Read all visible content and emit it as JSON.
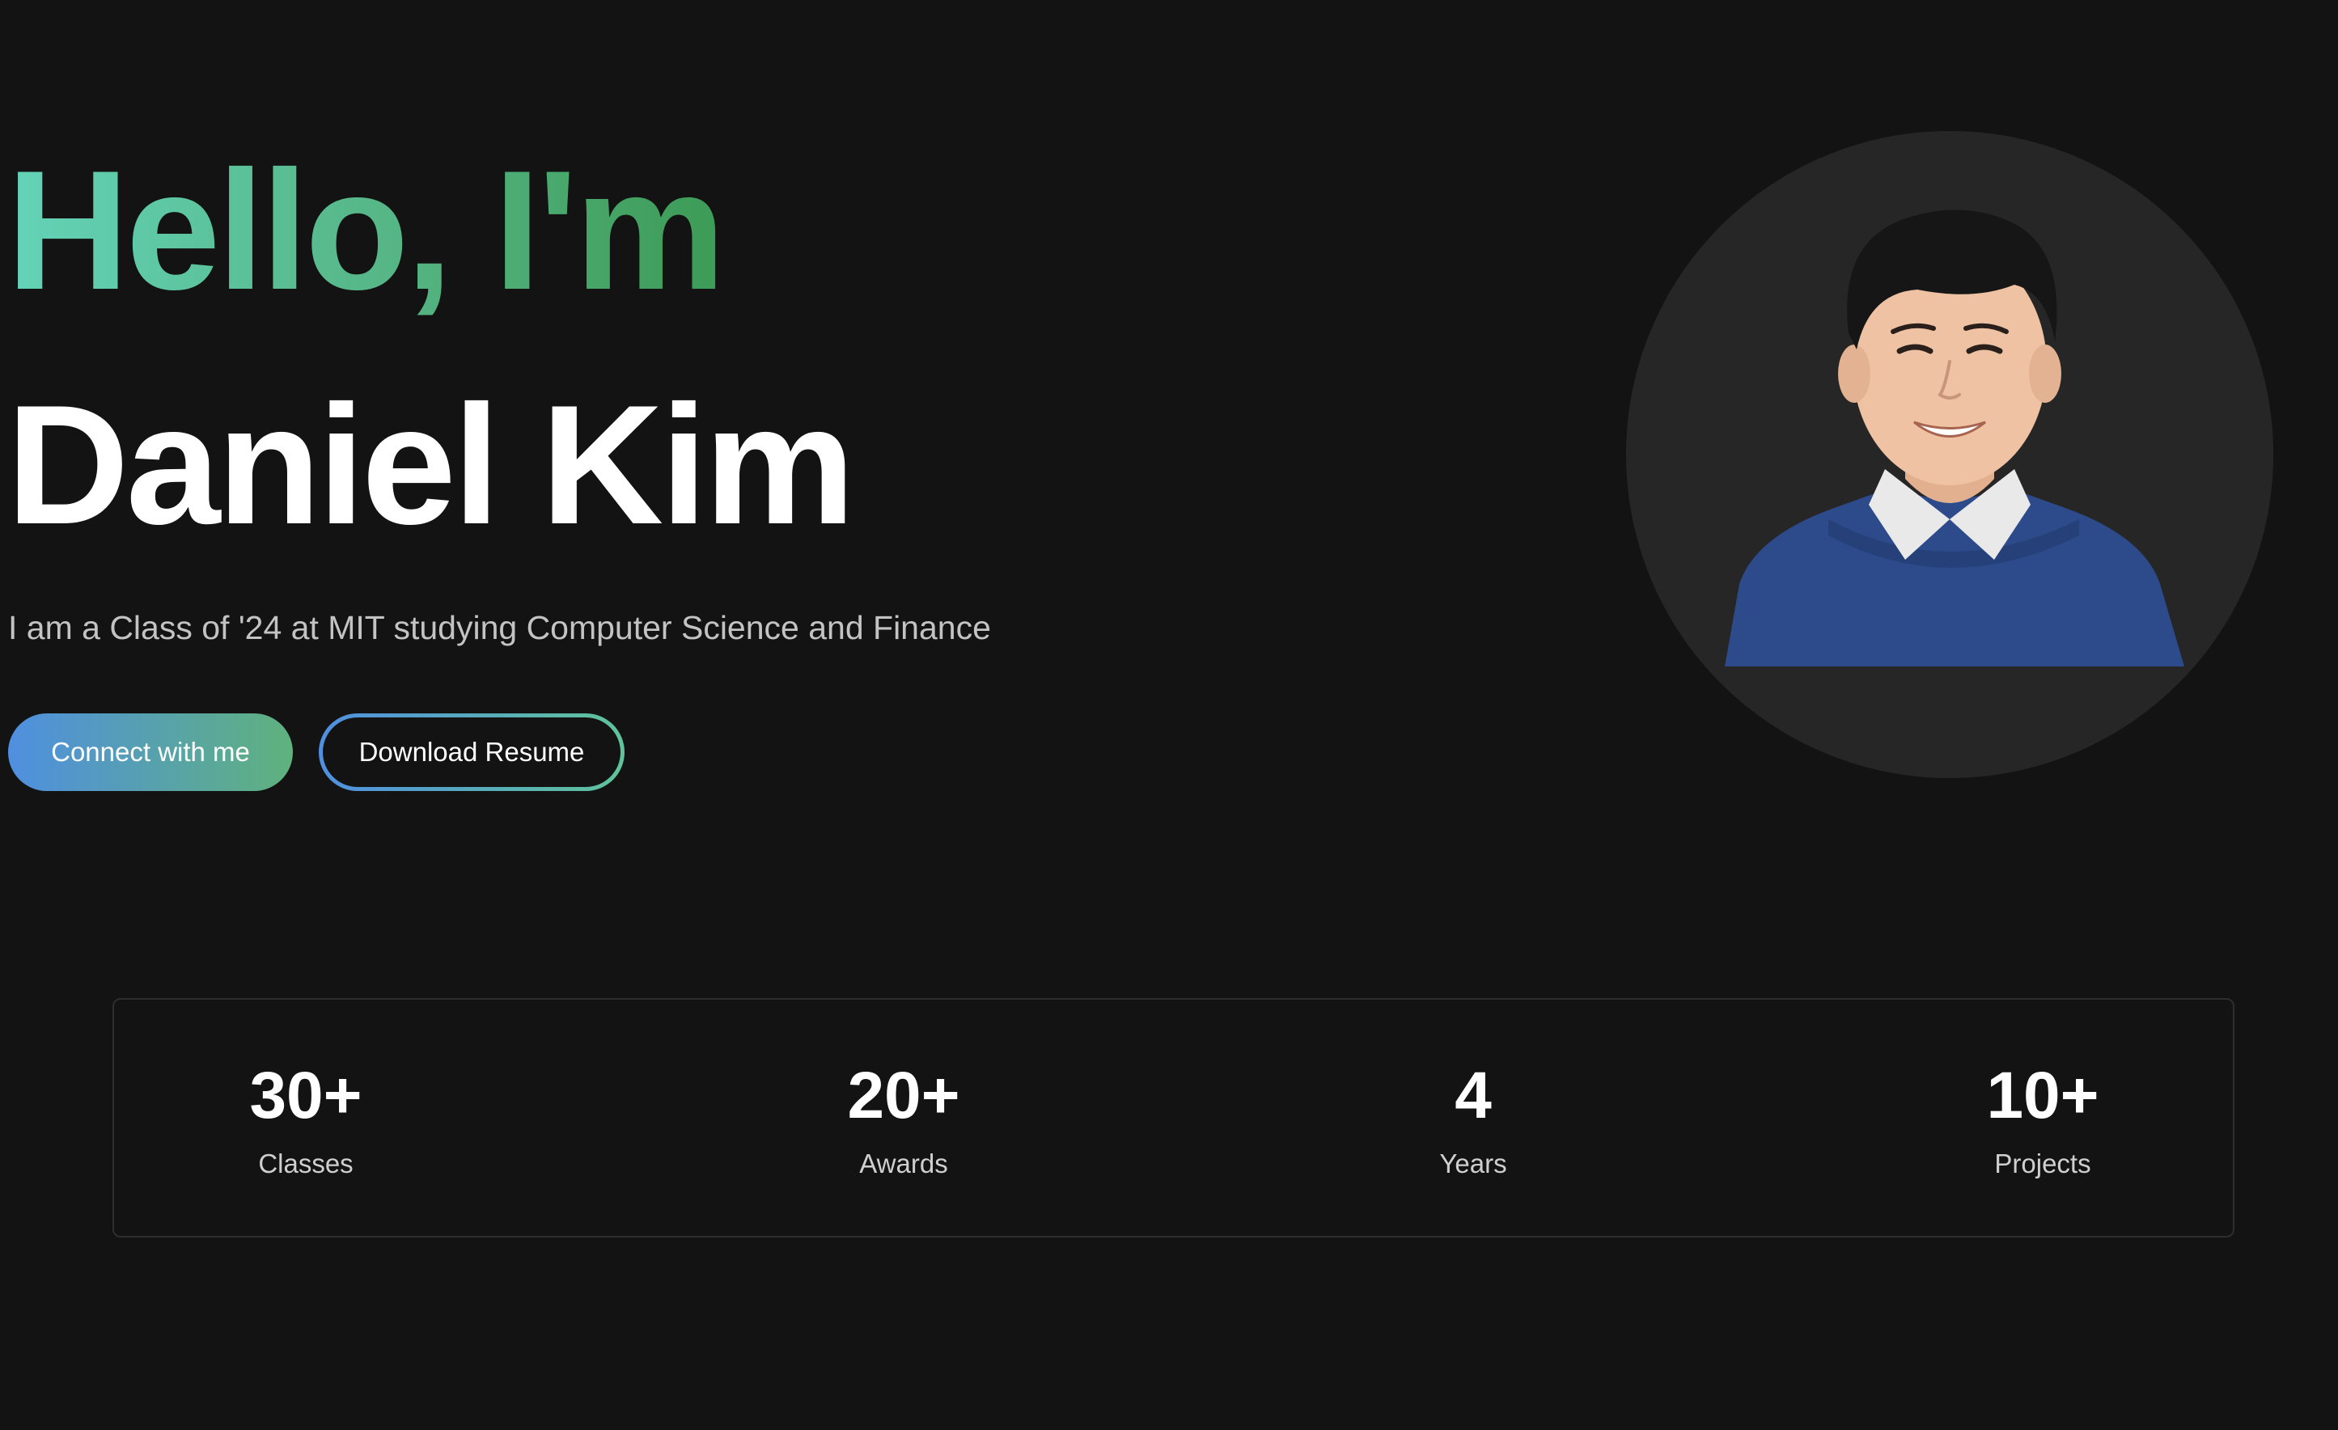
{
  "hero": {
    "greeting": "Hello, I'm",
    "name": "Daniel Kim",
    "tagline": "I am a Class of '24 at MIT studying Computer Science and Finance",
    "connect_label": "Connect with me",
    "resume_label": "Download Resume",
    "accent_gradient": [
      "#64d3b8",
      "#3c9b55"
    ],
    "button_gradient": [
      "#4f8fe0",
      "#5fb27d"
    ]
  },
  "profile": {
    "avatar_icon": "profile-photo"
  },
  "stats": [
    {
      "value": "30+",
      "label": "Classes"
    },
    {
      "value": "20+",
      "label": "Awards"
    },
    {
      "value": "4",
      "label": "Years"
    },
    {
      "value": "10+",
      "label": "Projects"
    }
  ]
}
